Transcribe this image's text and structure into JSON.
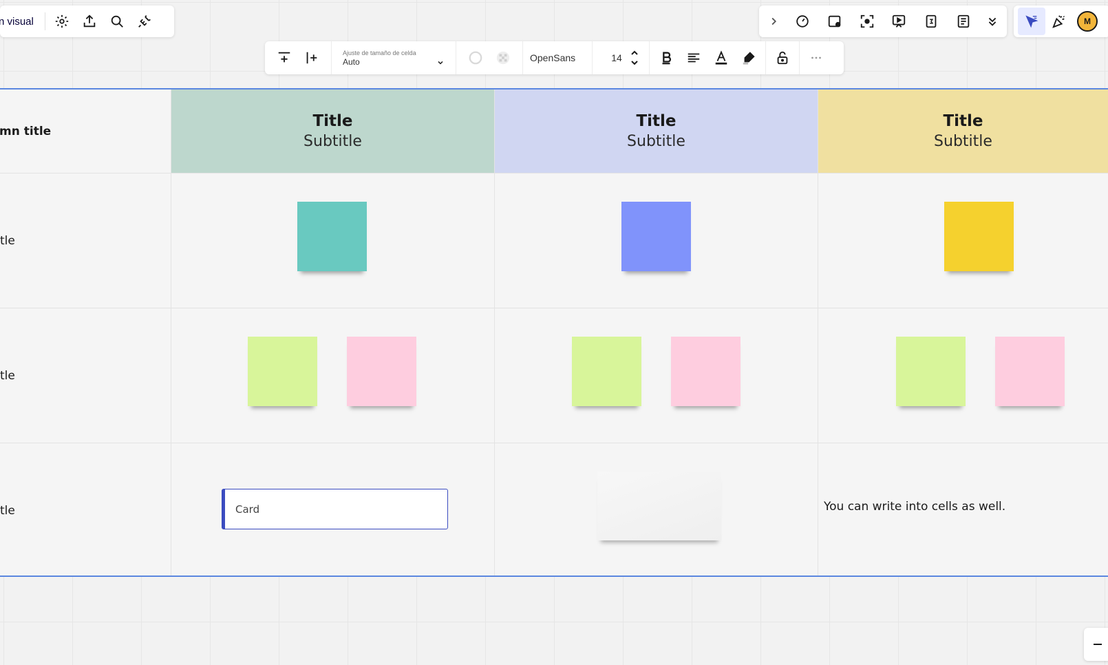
{
  "app": {
    "board_name": "n visual"
  },
  "context_toolbar": {
    "cell_size_caption": "Ajuste de tamaño de celda",
    "cell_size_value": "Auto",
    "font_family": "OpenSans",
    "font_size": "14"
  },
  "table": {
    "first_column_header": "mn title",
    "columns": [
      {
        "title": "Title",
        "subtitle": "Subtitle",
        "color": "#bdd7cd"
      },
      {
        "title": "Title",
        "subtitle": "Subtitle",
        "color": "#d0d6f2"
      },
      {
        "title": "Title",
        "subtitle": "Subtitle",
        "color": "#f0e0a0"
      }
    ],
    "row_labels": [
      "tle",
      "tle",
      "tle"
    ],
    "card_text": "Card",
    "cell_text": "You can write into cells as well."
  },
  "colors": {
    "teal": "#69c9c0",
    "blue": "#8093fb",
    "yellow": "#f5d12e",
    "green": "#d8f59a",
    "pink": "#fecddf",
    "selection": "#5b87e0",
    "avatar": "#f2b53a"
  },
  "avatar": {
    "initial": "M"
  },
  "icons": {
    "left": [
      "gear-icon",
      "export-icon",
      "search-icon",
      "plugin-icon"
    ],
    "right": [
      "chevron-right-icon",
      "timer-icon",
      "present-icon",
      "focus-icon",
      "presentation-icon",
      "count-icon",
      "notes-icon",
      "chevrons-down-icon"
    ],
    "modes": [
      "select-cursor-icon",
      "reactions-icon"
    ]
  }
}
